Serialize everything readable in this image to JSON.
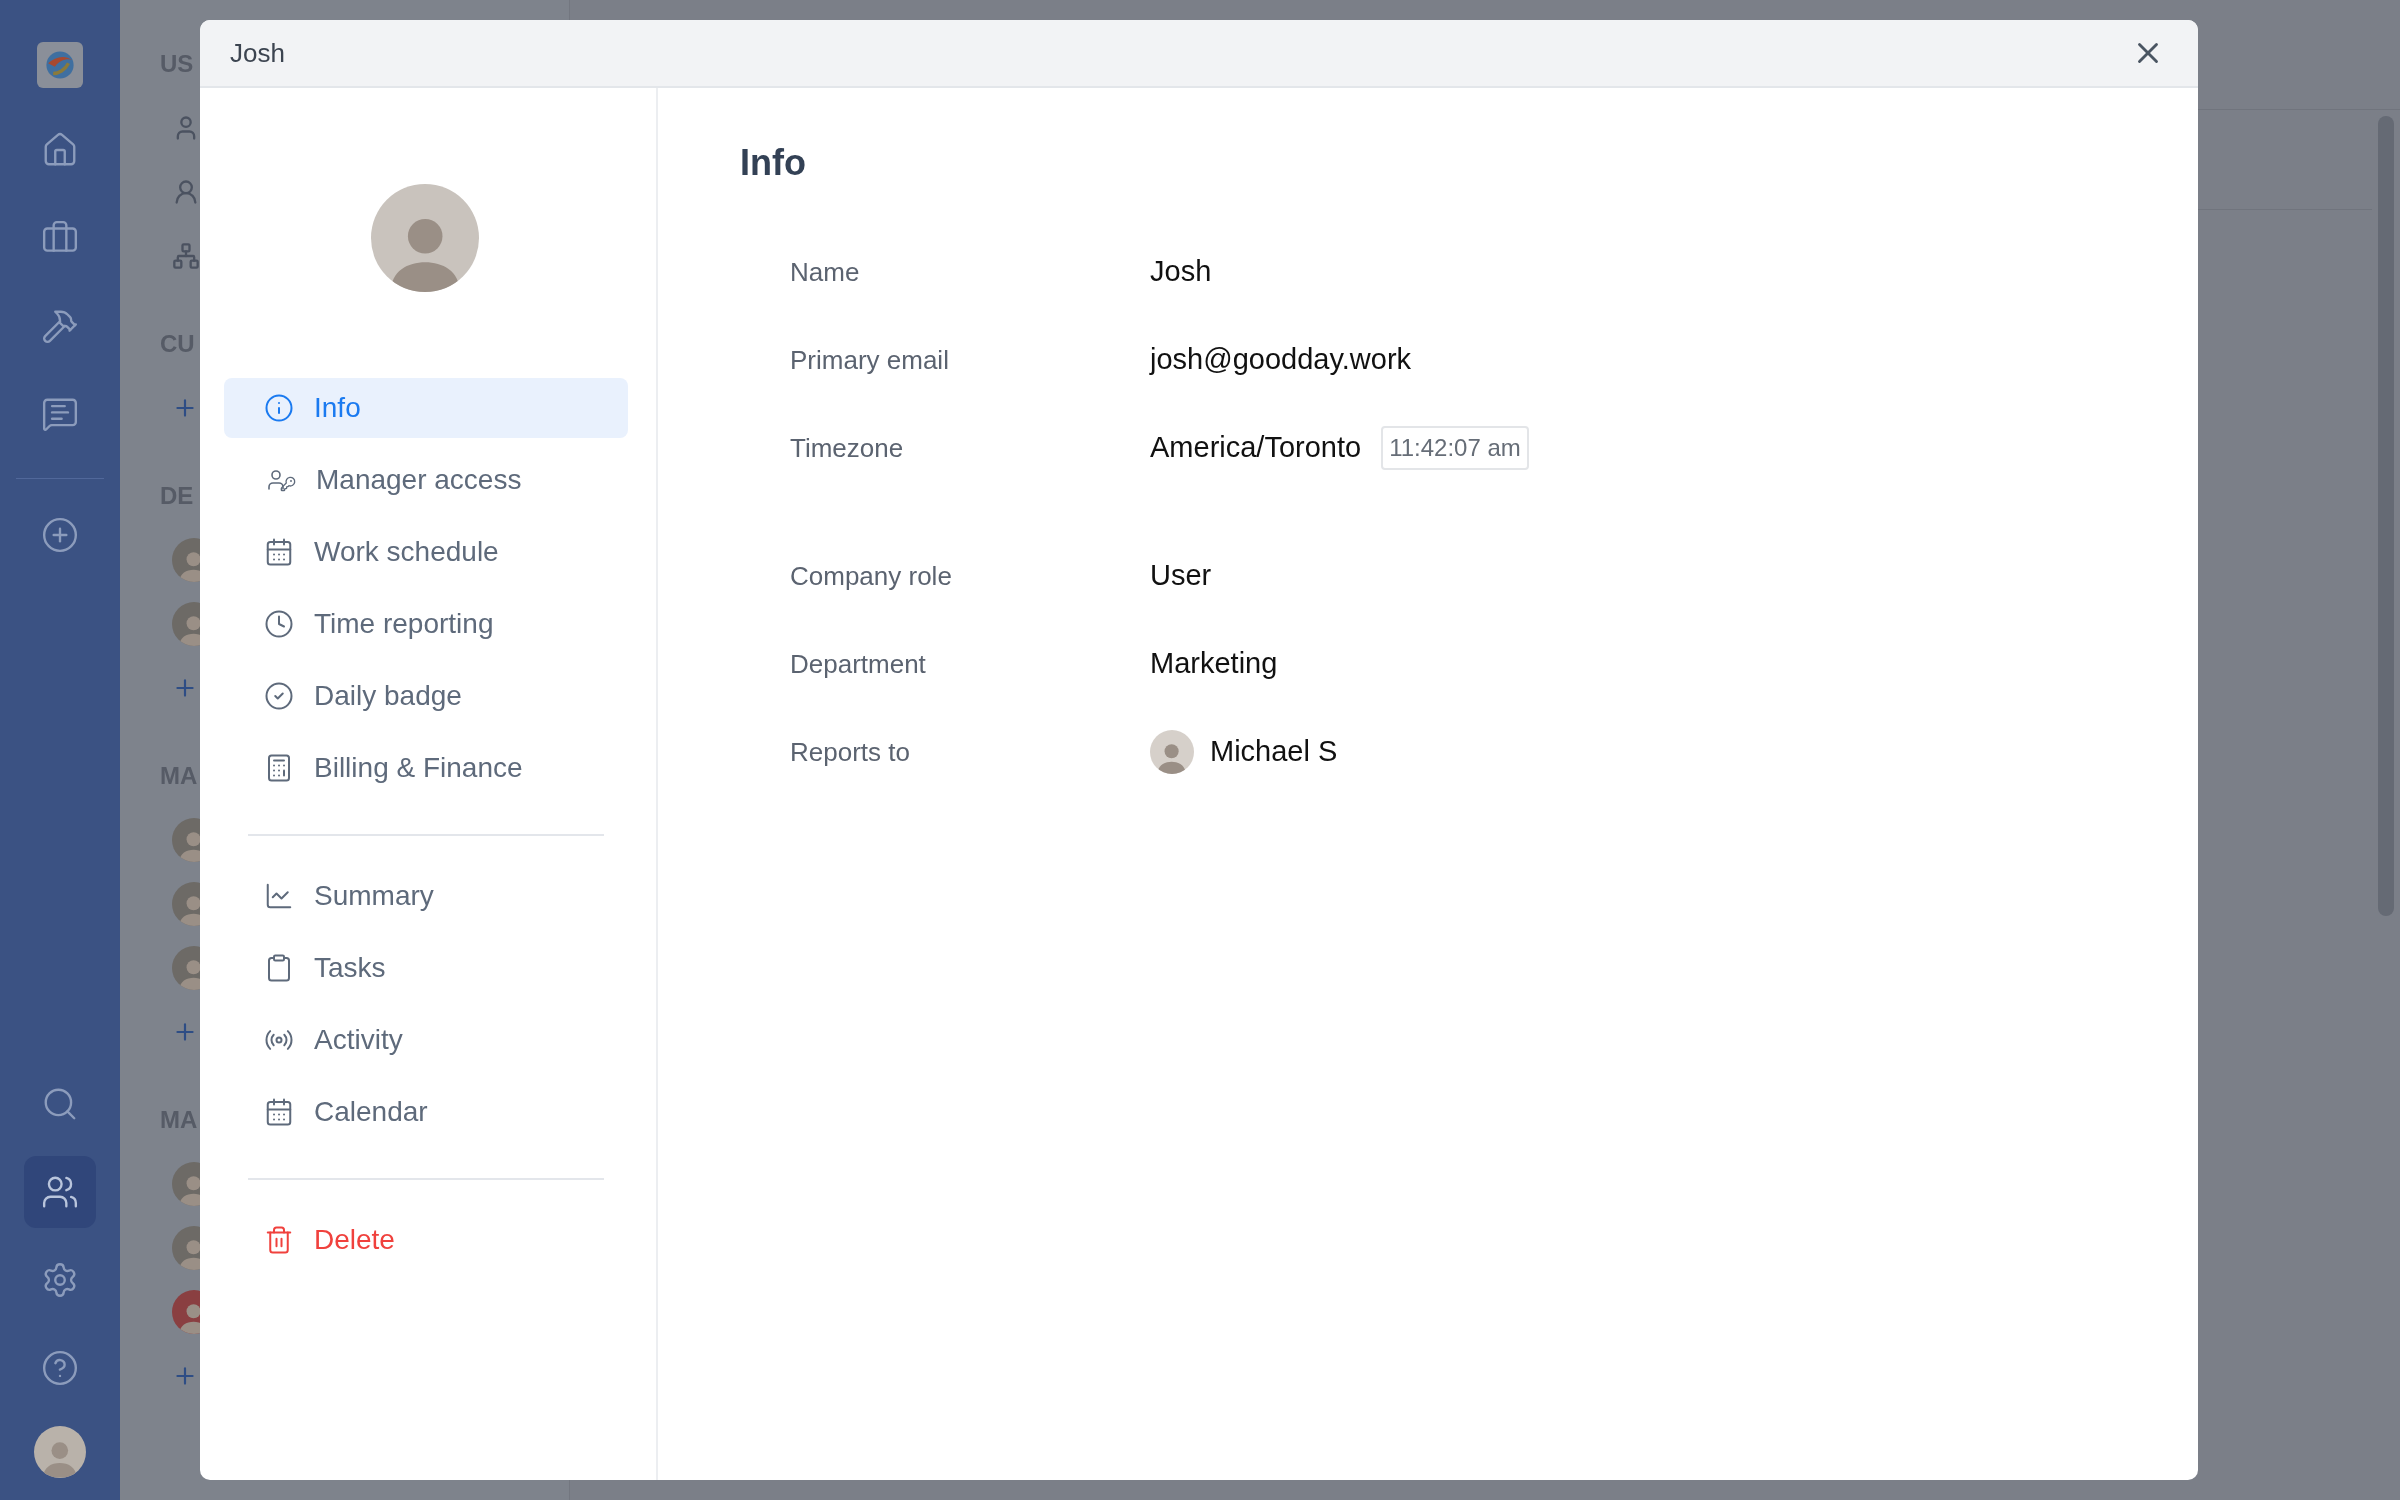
{
  "rail_top": [
    {
      "kind": "home",
      "selected": false
    },
    {
      "kind": "briefcase",
      "selected": false
    },
    {
      "kind": "tools",
      "selected": false
    },
    {
      "kind": "chat",
      "selected": false
    }
  ],
  "rail_bottom": [
    {
      "kind": "search",
      "selected": false
    },
    {
      "kind": "people",
      "selected": true
    },
    {
      "kind": "settings",
      "selected": false
    },
    {
      "kind": "help",
      "selected": false
    }
  ],
  "background_sidebar": [
    {
      "label": "US",
      "items": [
        {
          "kind": "user"
        },
        {
          "kind": "user-round"
        },
        {
          "kind": "org"
        }
      ]
    },
    {
      "label": "CU",
      "items": [
        {
          "kind": "add"
        }
      ]
    },
    {
      "label": "DE",
      "items": [
        {
          "kind": "avatar"
        },
        {
          "kind": "avatar"
        },
        {
          "kind": "add"
        }
      ]
    },
    {
      "label": "MA",
      "items": [
        {
          "kind": "avatar"
        },
        {
          "kind": "avatar"
        },
        {
          "kind": "avatar"
        },
        {
          "kind": "add"
        }
      ]
    },
    {
      "label": "MA",
      "items": [
        {
          "kind": "avatar"
        },
        {
          "kind": "avatar"
        },
        {
          "kind": "placeholder"
        },
        {
          "kind": "add"
        }
      ]
    }
  ],
  "dialog": {
    "title": "Josh",
    "nav_groups": [
      [
        {
          "label": "Info",
          "kind": "info",
          "selected": true
        },
        {
          "label": "Manager access",
          "kind": "manager",
          "selected": false
        },
        {
          "label": "Work schedule",
          "kind": "calendar",
          "selected": false
        },
        {
          "label": "Time reporting",
          "kind": "clock",
          "selected": false
        },
        {
          "label": "Daily badge",
          "kind": "check",
          "selected": false
        },
        {
          "label": "Billing & Finance",
          "kind": "billing",
          "selected": false
        }
      ],
      [
        {
          "label": "Summary",
          "kind": "chart",
          "selected": false
        },
        {
          "label": "Tasks",
          "kind": "clipboard",
          "selected": false
        },
        {
          "label": "Activity",
          "kind": "activity",
          "selected": false
        },
        {
          "label": "Calendar",
          "kind": "calendar",
          "selected": false
        }
      ],
      [
        {
          "label": "Delete",
          "kind": "delete",
          "selected": false
        }
      ]
    ],
    "heading": "Info",
    "field_groups": [
      [
        {
          "label": "Name",
          "value": "Josh"
        },
        {
          "label": "Primary email",
          "value": "josh@goodday.work"
        },
        {
          "label": "Timezone",
          "value": "America/Toronto",
          "time": "11:42:07 am"
        }
      ],
      [
        {
          "label": "Company role",
          "value": "User"
        },
        {
          "label": "Department",
          "value": "Marketing"
        },
        {
          "label": "Reports to",
          "value": "Michael S",
          "kind": "person"
        }
      ]
    ]
  }
}
